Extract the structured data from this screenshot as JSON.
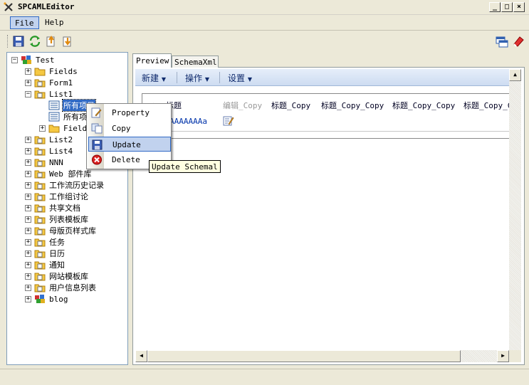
{
  "window": {
    "title": "SPCAMLEditor"
  },
  "menubar": {
    "items": [
      "File",
      "Help"
    ]
  },
  "toolbar": {
    "icons": [
      "save-icon",
      "refresh-icon",
      "export-icon",
      "import-icon",
      "window-icon",
      "eraser-icon"
    ]
  },
  "tree": {
    "root": "Test",
    "nodes": [
      "Fields",
      "Form1",
      "List1",
      "所有项目",
      "所有项",
      "Fields",
      "List2",
      "List4",
      "NNN",
      "Web 部件库",
      "工作流历史记录",
      "工作组讨论",
      "共享文档",
      "列表模板库",
      "母版页样式库",
      "任务",
      "日历",
      "通知",
      "网站模板库",
      "用户信息列表",
      "blog"
    ]
  },
  "tabs": [
    "Preview",
    "SchemaXml"
  ],
  "preview": {
    "toolbar": [
      "新建",
      "操作",
      "设置"
    ],
    "columns": [
      "标题",
      "编辑_Copy",
      "标题_Copy",
      "标题_Copy_Copy",
      "标题_Copy_Copy",
      "标题_Copy_C"
    ],
    "row": {
      "title": "AAAAAAAa"
    }
  },
  "context_menu": {
    "items": [
      {
        "label": "Property",
        "icon": "property-icon"
      },
      {
        "label": "Copy",
        "icon": "copy-icon"
      },
      {
        "label": "Update",
        "icon": "update-icon"
      },
      {
        "label": "Delete",
        "icon": "delete-icon"
      }
    ],
    "tooltip": "Update Schemal"
  },
  "colors": {
    "selection": "#316ac5",
    "hover": "#c1d2ee",
    "sp_link": "#0f2a6c"
  }
}
